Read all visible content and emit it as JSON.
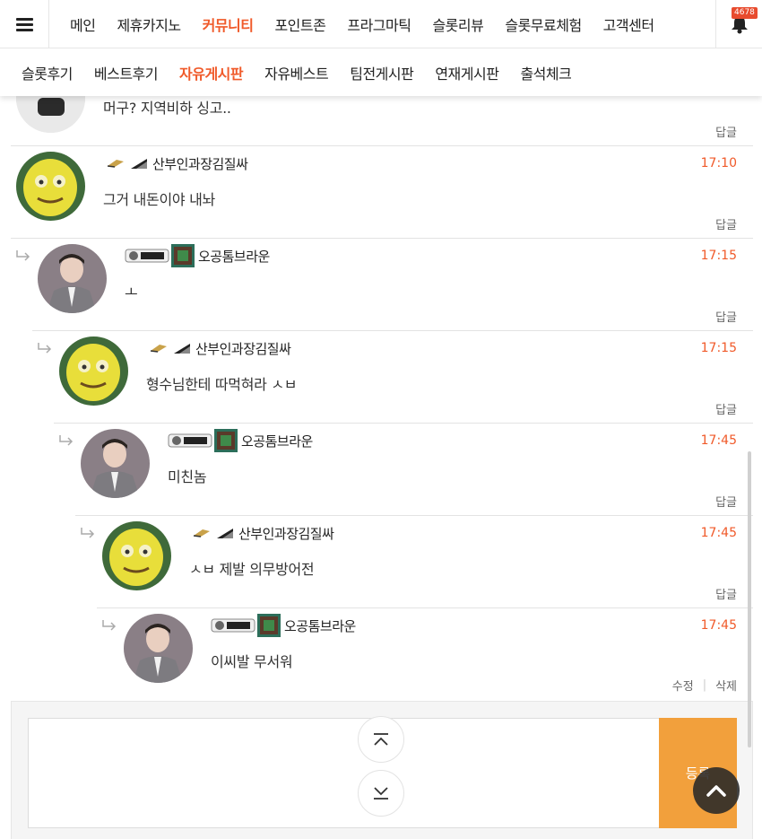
{
  "top_nav": {
    "menu_items": [
      "메인",
      "제휴카지노",
      "커뮤니티",
      "포인트존",
      "프라그마틱",
      "슬롯리뷰",
      "슬롯무료체험",
      "고객센터"
    ],
    "active_index": 2,
    "notification_count": "4678"
  },
  "sub_nav": {
    "items": [
      "슬롯후기",
      "베스트후기",
      "자유게시판",
      "자유베스트",
      "팀전게시판",
      "연재게시판",
      "출석체크"
    ],
    "active_index": 2
  },
  "comments": [
    {
      "author": "",
      "time": "",
      "text": "머구? 지역비하 싱고..",
      "reply_label": "답글"
    },
    {
      "author": "산부인과장김질싸",
      "time": "17:10",
      "text": "그거 내돈이야 내놔",
      "reply_label": "답글"
    },
    {
      "author": "오공톰브라운",
      "time": "17:15",
      "text": "ㅗ",
      "reply_label": "답글"
    },
    {
      "author": "산부인과장김질싸",
      "time": "17:15",
      "text": "형수님한테 따먹혀라 ㅅㅂ",
      "reply_label": "답글"
    },
    {
      "author": "오공톰브라운",
      "time": "17:45",
      "text": "미친놈",
      "reply_label": "답글"
    },
    {
      "author": "산부인과장김질싸",
      "time": "17:45",
      "text": "ㅅㅂ 제발 의무방어전",
      "reply_label": "답글"
    },
    {
      "author": "오공톰브라운",
      "time": "17:45",
      "text": "이씨발 무서워",
      "edit_label": "수정",
      "delete_label": "삭제"
    }
  ],
  "comment_form": {
    "submit_label": "등록"
  },
  "colors": {
    "accent": "#f05a2a",
    "submit": "#f2a03c",
    "badge": "#e84b2e"
  }
}
